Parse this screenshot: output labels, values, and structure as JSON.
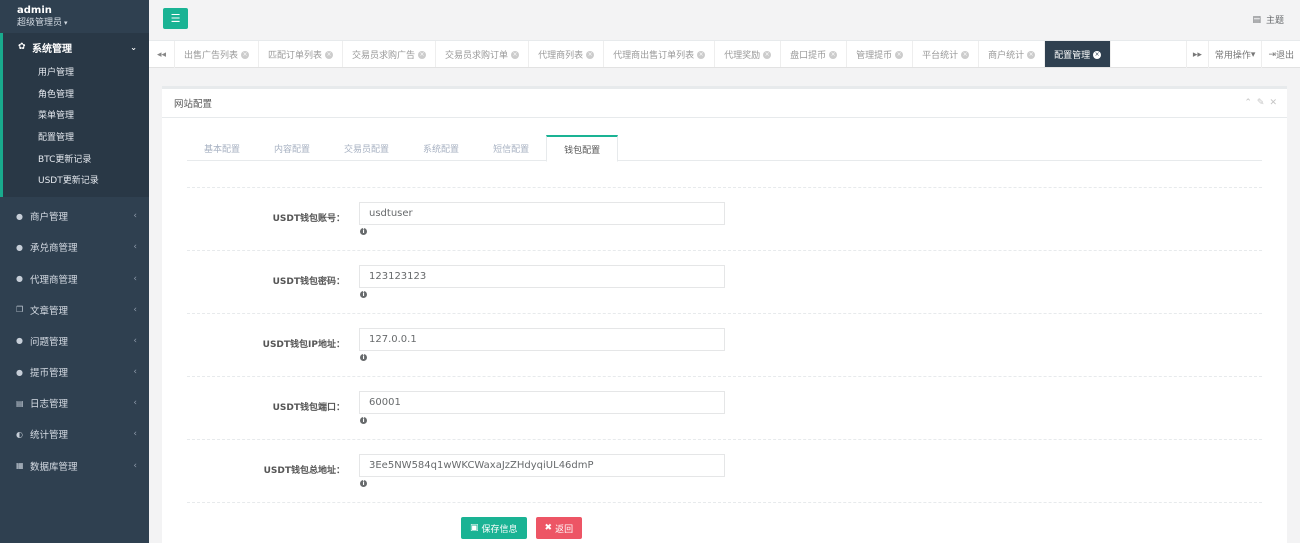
{
  "profile": {
    "name": "admin",
    "role": "超级管理员"
  },
  "sidebar": {
    "active": {
      "label": "系统管理",
      "subitems": [
        "用户管理",
        "角色管理",
        "菜单管理",
        "配置管理",
        "BTC更新记录",
        "USDT更新记录"
      ]
    },
    "items": [
      {
        "label": "商户管理",
        "icon": "user-icon"
      },
      {
        "label": "承兑商管理",
        "icon": "user-icon"
      },
      {
        "label": "代理商管理",
        "icon": "user-icon"
      },
      {
        "label": "文章管理",
        "icon": "copy-icon"
      },
      {
        "label": "问题管理",
        "icon": "comment-icon"
      },
      {
        "label": "提币管理",
        "icon": "user-icon"
      },
      {
        "label": "日志管理",
        "icon": "list-icon"
      },
      {
        "label": "统计管理",
        "icon": "pie-icon"
      },
      {
        "label": "数据库管理",
        "icon": "database-icon"
      }
    ]
  },
  "topbar": {
    "theme_label": "主题"
  },
  "tabs": [
    "出售广告列表",
    "匹配订单列表",
    "交易员求购广告",
    "交易员求购订单",
    "代理商列表",
    "代理商出售订单列表",
    "代理奖励",
    "盘口提币",
    "管理提币",
    "平台统计",
    "商户统计",
    "配置管理"
  ],
  "tabs_right": {
    "ops": "常用操作",
    "logout": "退出"
  },
  "panel": {
    "title": "网站配置",
    "config_tabs": [
      "基本配置",
      "内容配置",
      "交易员配置",
      "系统配置",
      "短信配置",
      "钱包配置"
    ],
    "fields": [
      {
        "label": "USDT钱包账号：",
        "value": "usdtuser"
      },
      {
        "label": "USDT钱包密码：",
        "value": "123123123"
      },
      {
        "label": "USDT钱包IP地址：",
        "value": "127.0.0.1"
      },
      {
        "label": "USDT钱包端口：",
        "value": "60001"
      },
      {
        "label": "USDT钱包总地址：",
        "value": "3Ee5NW584q1wWKCWaxaJzZHdyqiUL46dmP"
      }
    ],
    "save_label": "保存信息",
    "back_label": "返回"
  }
}
